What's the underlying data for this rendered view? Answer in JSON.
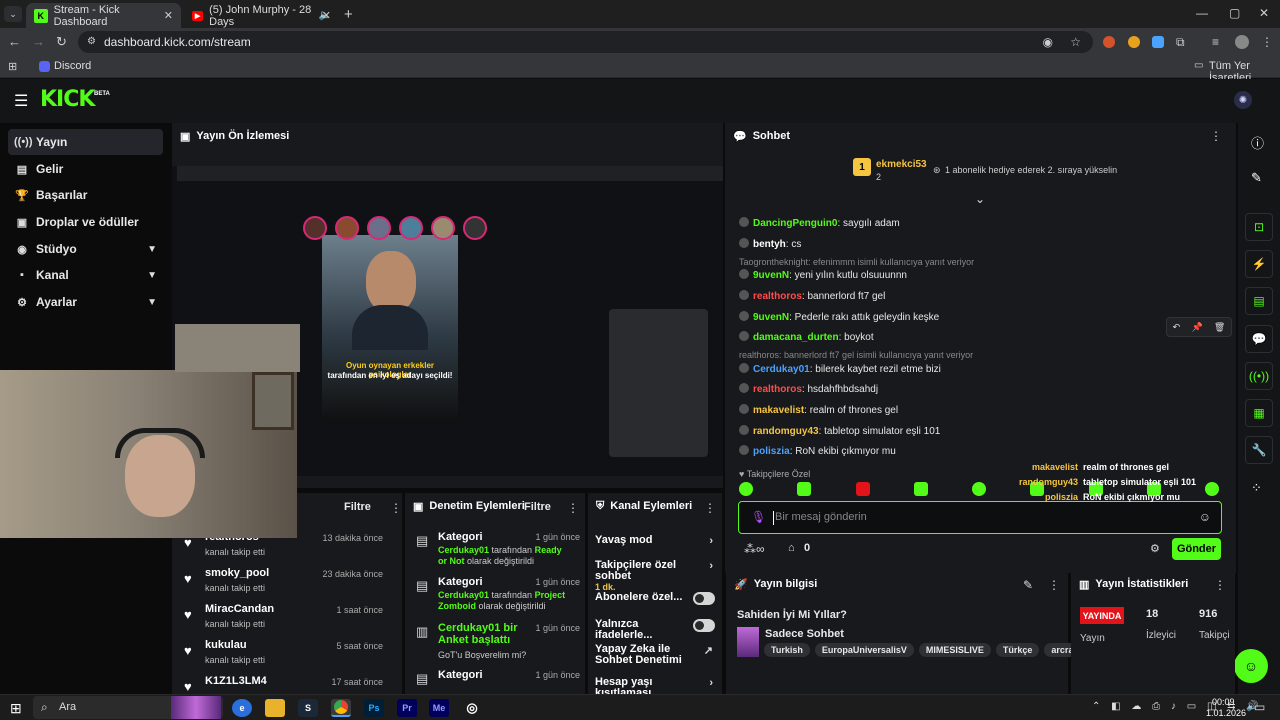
{
  "browser": {
    "tabs": [
      {
        "title": "Stream - Kick Dashboard"
      },
      {
        "title": "(5) John Murphy - 28 Days"
      }
    ],
    "url": "dashboard.kick.com/stream",
    "bookmark": "Discord",
    "bookmarks_all": "Tüm Yer İşaretleri"
  },
  "sidebar": {
    "logo": "KICK",
    "beta": "BETA",
    "items": [
      {
        "label": "Yayın",
        "icon": "stream-icon"
      },
      {
        "label": "Gelir",
        "icon": "revenue-icon"
      },
      {
        "label": "Başarılar",
        "icon": "trophy-icon"
      },
      {
        "label": "Droplar ve ödüller",
        "icon": "gift-icon"
      },
      {
        "label": "Stüdyo",
        "icon": "studio-icon"
      },
      {
        "label": "Kanal",
        "icon": "channel-icon"
      },
      {
        "label": "Ayarlar",
        "icon": "gear-icon"
      }
    ]
  },
  "preview": {
    "title": "Yayın Ön İzlemesi",
    "promo_line1": "Oyun oynayan erkekler psikologlar",
    "promo_line2": "tarafından en iyi eş adayı seçildi!"
  },
  "chat": {
    "title": "Sohbet",
    "top_user": "ekmekci53",
    "top_count": "2",
    "top_rank": "1",
    "top_message": "1 abonelik hediye ederek 2. sıraya yükselin",
    "messages": [
      {
        "user": "DancingPenguin0",
        "color": "#53fc18",
        "text": ": saygılı adam",
        "reply": ""
      },
      {
        "user": "bentyh",
        "color": "#ffffff",
        "text": ": cs",
        "reply": ""
      },
      {
        "user": "9uvenN",
        "color": "#53fc18",
        "text": ": yeni yılın kutlu olsuuunnn",
        "reply": "Taogrontheknight: efenimmm isimli kullanıcıya yanıt veriyor"
      },
      {
        "user": "realthoros",
        "color": "#ff4d4d",
        "text": ": bannerlord ft7 gel",
        "reply": ""
      },
      {
        "user": "9uvenN",
        "color": "#53fc18",
        "text": ": Pederle rakı attık geleydin keşke",
        "reply": ""
      },
      {
        "user": "damacana_durten",
        "color": "#53fc18",
        "text": ": boykot",
        "reply": ""
      },
      {
        "user": "Cerdukay01",
        "color": "#4aa3ff",
        "text": ": bilerek kaybet rezil etme bizi",
        "reply": "realthoros: bannerlord ft7 gel isimli kullanıcıya yanıt veriyor"
      },
      {
        "user": "realthoros",
        "color": "#ff4d4d",
        "text": ": hsdahfhbdsahdj",
        "reply": ""
      },
      {
        "user": "makavelist",
        "color": "#f5c542",
        "text": ": realm of thrones gel",
        "reply": ""
      },
      {
        "user": "randomguy43",
        "color": "#f5c542",
        "text": ": tabletop simulator eşli 101",
        "reply": ""
      },
      {
        "user": "polisziа",
        "color": "#4aa3ff",
        "text": ": RoN ekibi çıkmıyor mu",
        "reply": ""
      }
    ],
    "followers_only": "Takipçilere Özel",
    "overlay": [
      {
        "user": "makavelist",
        "text": "realm of thrones gel"
      },
      {
        "user": "randomguy43",
        "text": "tabletop simulator eşli 101"
      },
      {
        "user": "polisziа",
        "text": "RoN ekibi çıkmıyor mu"
      }
    ],
    "input_placeholder": "Bir mesaj gönderin",
    "points": "0",
    "send": "Gönder"
  },
  "followers": {
    "filter": "Filtre",
    "items": [
      {
        "name": "realthoros",
        "sub": "kanalı takip etti",
        "time": "13 dakika önce"
      },
      {
        "name": "smoky_pool",
        "sub": "kanalı takip etti",
        "time": "23 dakika önce"
      },
      {
        "name": "MiracCandan",
        "sub": "kanalı takip etti",
        "time": "1 saat önce"
      },
      {
        "name": "kukulau",
        "sub": "kanalı takip etti",
        "time": "5 saat önce"
      },
      {
        "name": "K1Z1L3LM4",
        "sub": "",
        "time": "17 saat önce"
      }
    ]
  },
  "moderation": {
    "title": "Denetim Eylemleri",
    "filter": "Filtre",
    "items": [
      {
        "head": "Kategori",
        "time": "1 gün önce",
        "user": "Cerdukay01",
        "mid": " tarafından ",
        "val": "Ready or Not",
        "end": " olarak değiştirildi"
      },
      {
        "head": "Kategori",
        "time": "1 gün önce",
        "user": "Cerdukay01",
        "mid": " tarafından ",
        "val": "Project Zomboid",
        "end": " olarak değiştirildi"
      },
      {
        "head": "Cerdukay01 bir Anket başlattı",
        "time": "1 gün önce",
        "sub": "GoT'u Boşverelim mi?"
      },
      {
        "head": "Kategori",
        "time": "1 gün önce"
      }
    ]
  },
  "channel_actions": {
    "title": "Kanal Eylemleri",
    "items": [
      {
        "label": "Yavaş mod",
        "sub": ""
      },
      {
        "label": "Takipçilere özel sohbet",
        "sub": "1 dk."
      },
      {
        "label": "Abonelere özel...",
        "sub": ""
      },
      {
        "label": "Yalnızca ifadelerle...",
        "sub": ""
      },
      {
        "label": "Yapay Zeka ile Sohbet Denetimi",
        "sub": ""
      },
      {
        "label": "Hesap yaşı kısıtlaması",
        "sub": ""
      }
    ]
  },
  "stream_info": {
    "title": "Yayın bilgisi",
    "stream_title": "Sahiden İyi Mi Yıllar?",
    "category": "Sadece Sohbet",
    "tags": [
      "Turkish",
      "EuropaUniversalisV",
      "MIMESISLIVE",
      "Türkçe",
      "arcraiders"
    ]
  },
  "stats": {
    "title": "Yayın İstatistikleri",
    "live": "YAYINDA",
    "live_label": "Yayın",
    "viewers": "18",
    "viewers_label": "İzleyici",
    "followers": "916",
    "followers_label": "Takipçi"
  },
  "taskbar": {
    "search": "Ara",
    "time": "00:09",
    "date": "1.01.2026"
  },
  "colors": {
    "brand": "#53fc18",
    "live": "#e3131a"
  }
}
